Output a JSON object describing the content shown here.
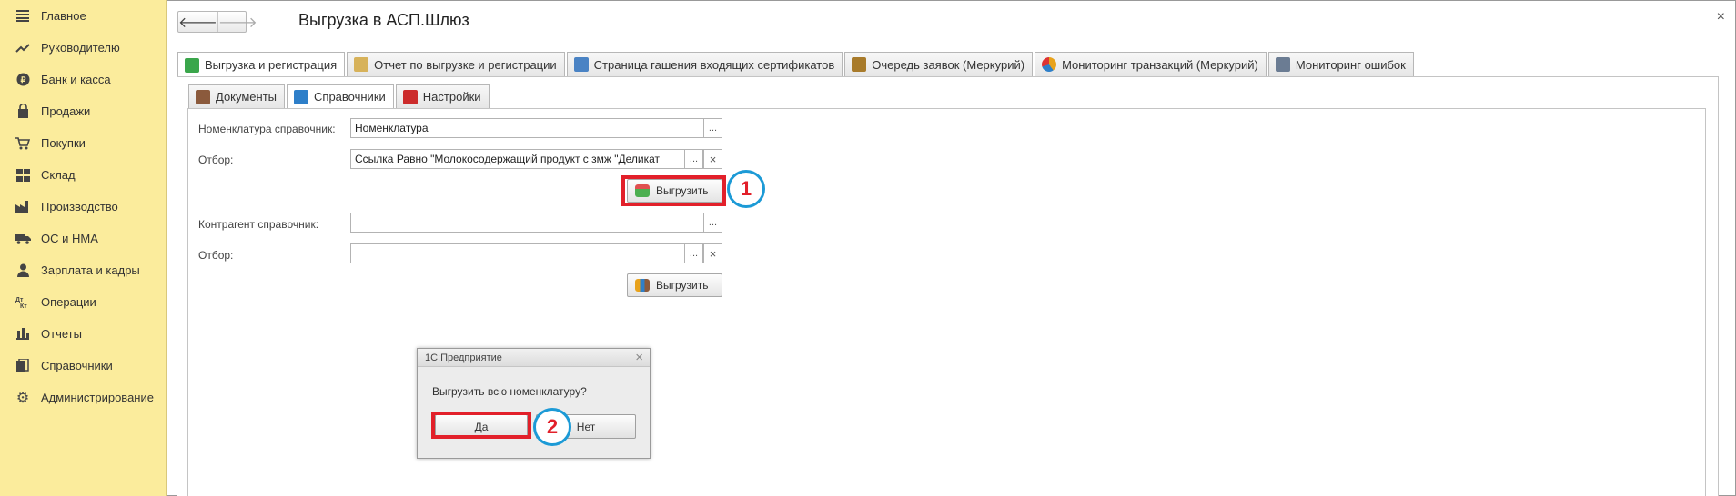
{
  "sidebar": {
    "items": [
      {
        "label": "Главное",
        "icon": "menu-icon"
      },
      {
        "label": "Руководителю",
        "icon": "trend-icon"
      },
      {
        "label": "Банк и касса",
        "icon": "coin-icon"
      },
      {
        "label": "Продажи",
        "icon": "bag-icon"
      },
      {
        "label": "Покупки",
        "icon": "cart-icon"
      },
      {
        "label": "Склад",
        "icon": "warehouse-icon"
      },
      {
        "label": "Производство",
        "icon": "factory-icon"
      },
      {
        "label": "ОС и НМА",
        "icon": "truck-icon"
      },
      {
        "label": "Зарплата и кадры",
        "icon": "person-icon"
      },
      {
        "label": "Операции",
        "icon": "dt-kt-icon"
      },
      {
        "label": "Отчеты",
        "icon": "bar-chart-icon"
      },
      {
        "label": "Справочники",
        "icon": "book-icon"
      },
      {
        "label": "Администрирование",
        "icon": "gear-icon"
      }
    ]
  },
  "header": {
    "title": "Выгрузка в АСП.Шлюз",
    "back_glyph": "🡐",
    "forward_glyph": "🡒",
    "close_glyph": "×"
  },
  "main_tabs": [
    {
      "label": "Выгрузка и регистрация",
      "icon": "upload-icon",
      "color": "#3aa64b"
    },
    {
      "label": "Отчет по выгрузке и регистрации",
      "icon": "report-icon",
      "color": "#d7b25a"
    },
    {
      "label": "Страница гашения входящих сертификатов",
      "icon": "certificate-icon",
      "color": "#4a83c4"
    },
    {
      "label": "Очередь заявок (Меркурий)",
      "icon": "queue-icon",
      "color": "#a87b2b"
    },
    {
      "label": "Мониторинг транзакций (Меркурий)",
      "icon": "pie-icon",
      "color": "#e8a21b"
    },
    {
      "label": "Мониторинг ошибок",
      "icon": "monitor-icon",
      "color": "#6b7c93"
    }
  ],
  "sub_tabs": [
    {
      "label": "Документы",
      "icon": "briefcase-icon",
      "color": "#8b5a3c"
    },
    {
      "label": "Справочники",
      "icon": "directory-icon",
      "color": "#2e7fc9"
    },
    {
      "label": "Настройки",
      "icon": "settings-icon",
      "color": "#cc2b2b"
    }
  ],
  "form": {
    "nomenclature_label": "Номенклатура справочник:",
    "nomenclature_value": "Номенклатура",
    "filter1_label": "Отбор:",
    "filter1_value": "Ссылка Равно \"Молокосодержащий продукт с змж \"Деликат",
    "upload1_label": "Выгрузить",
    "counterparty_label": "Контрагент справочник:",
    "counterparty_value": "",
    "filter2_label": "Отбор:",
    "filter2_value": "",
    "upload2_label": "Выгрузить",
    "ellipsis": "...",
    "clear": "×"
  },
  "annotations": {
    "step1": "1",
    "step2": "2",
    "highlight_color": "#e2202a",
    "circle_color": "#1c9ad6"
  },
  "dialog": {
    "title": "1С:Предприятие",
    "message": "Выгрузить всю номенклатуру?",
    "yes": "Да",
    "no": "Нет",
    "close_glyph": "×"
  }
}
